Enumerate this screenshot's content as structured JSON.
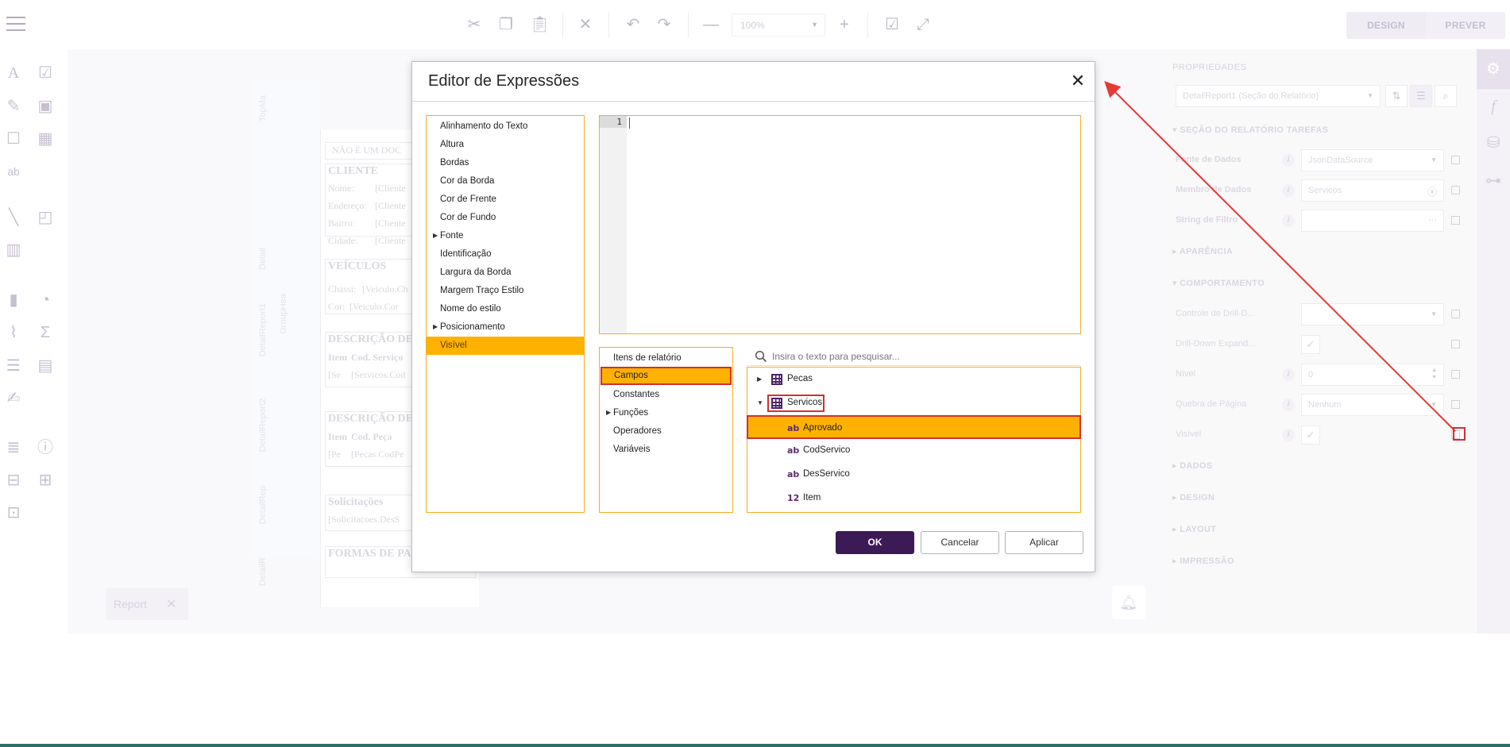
{
  "toolbar": {
    "zoom_value": "100%",
    "design_label": "DESIGN",
    "preview_label": "PREVER",
    "icons": [
      "menu-icon",
      "cut-icon",
      "copy-icon",
      "paste-icon",
      "delete-icon",
      "undo-icon",
      "redo-icon",
      "zoom-out-icon",
      "zoom-in-icon",
      "validate-icon",
      "fullscreen-icon"
    ]
  },
  "canvas": {
    "band_labels": [
      "TopMa",
      "Detail",
      "DetailReport1",
      "GroupHea",
      "DetailReport2",
      "DetailRep",
      "DetailR"
    ],
    "lines": [
      "NÃO É UM DOC",
      "CLIENTE",
      "Nome:",
      "Endereço:",
      "Bairro:",
      "Cidade:",
      "[Cliente",
      "VEÍCULOS",
      "Chassi:",
      "[Veiculo.Ch",
      "Cor:",
      "[Veiculo.Cor",
      "DESCRIÇÃO DE",
      "Item",
      "Cod. Serviço",
      "[Se",
      "[Servicos.Cod",
      "DESCRIÇÃO DE",
      "Cod. Peça",
      "[Pe",
      "[Pecas.CodPe",
      "Solicitações",
      "[Solicitacoes.DesS",
      "FORMAS DE PA"
    ],
    "report_tab": "Report"
  },
  "properties": {
    "title": "PROPRIEDADES",
    "selected_component": "DetailReport1 (Seção do Relatório)",
    "section_main": "SEÇÃO DO RELATÓRIO TAREFAS",
    "fields": [
      {
        "label": "Fonte de Dados",
        "value": "JsonDataSource"
      },
      {
        "label": "Membro de Dados",
        "value": "Servicos"
      },
      {
        "label": "String de Filtro",
        "value": ""
      }
    ],
    "section_appearance": "APARÊNCIA",
    "section_behavior": "COMPORTAMENTO",
    "behavior_fields": [
      {
        "label": "Controle de Drill-D...",
        "value": ""
      },
      {
        "label": "Drill-Down Expand...",
        "value": ""
      },
      {
        "label": "Nível",
        "value": "0"
      },
      {
        "label": "Quebra de Página",
        "value": "Nenhum"
      },
      {
        "label": "Visível",
        "value": ""
      }
    ],
    "sections_collapsed": [
      "DADOS",
      "DESIGN",
      "LAYOUT",
      "IMPRESSÃO"
    ]
  },
  "dialog": {
    "title": "Editor de Expressões",
    "properties_list": [
      {
        "label": "Alinhamento do Texto",
        "expandable": false,
        "selected": false
      },
      {
        "label": "Altura",
        "expandable": false,
        "selected": false
      },
      {
        "label": "Bordas",
        "expandable": false,
        "selected": false
      },
      {
        "label": "Cor da Borda",
        "expandable": false,
        "selected": false
      },
      {
        "label": "Cor de Frente",
        "expandable": false,
        "selected": false
      },
      {
        "label": "Cor de Fundo",
        "expandable": false,
        "selected": false
      },
      {
        "label": "Fonte",
        "expandable": true,
        "selected": false
      },
      {
        "label": "Identificação",
        "expandable": false,
        "selected": false
      },
      {
        "label": "Largura da Borda",
        "expandable": false,
        "selected": false
      },
      {
        "label": "Margem Traço Estilo",
        "expandable": false,
        "selected": false
      },
      {
        "label": "Nome do estilo",
        "expandable": false,
        "selected": false
      },
      {
        "label": "Posicionamento",
        "expandable": true,
        "selected": false
      },
      {
        "label": "Visível",
        "expandable": false,
        "selected": true
      }
    ],
    "editor": {
      "line_number": "1",
      "content": ""
    },
    "categories": [
      {
        "label": "Itens de relatório",
        "expandable": false,
        "selected": false
      },
      {
        "label": "Campos",
        "expandable": false,
        "selected": true
      },
      {
        "label": "Constantes",
        "expandable": false,
        "selected": false
      },
      {
        "label": "Funções",
        "expandable": true,
        "selected": false
      },
      {
        "label": "Operadores",
        "expandable": false,
        "selected": false
      },
      {
        "label": "Variáveis",
        "expandable": false,
        "selected": false
      }
    ],
    "search_placeholder": "Insira o texto para pesquisar...",
    "fields_tree": {
      "pecas": "Pecas",
      "servicos": "Servicos",
      "children": [
        {
          "type": "ab",
          "label": "Aprovado",
          "selected": true
        },
        {
          "type": "ab",
          "label": "CodServico",
          "selected": false
        },
        {
          "type": "ab",
          "label": "DesServico",
          "selected": false
        },
        {
          "type": "12",
          "label": "Item",
          "selected": false
        }
      ]
    },
    "buttons": {
      "ok": "OK",
      "cancel": "Cancelar",
      "apply": "Aplicar"
    }
  },
  "colors": {
    "accent": "#ffb100",
    "primary": "#3b1a55",
    "highlight": "#d32f2f",
    "frame": "#f3ae22"
  }
}
